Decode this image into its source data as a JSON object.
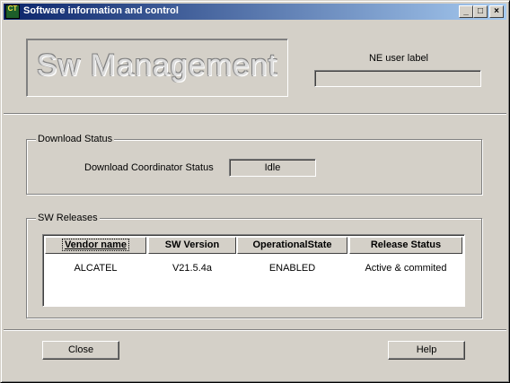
{
  "window": {
    "title": "Software information and control",
    "app_icon_text": "CT",
    "minimize_glyph": "_",
    "maximize_glyph": "□",
    "close_glyph": "×"
  },
  "header": {
    "logo_text": "Sw Management",
    "ne_user_label": "NE user label",
    "ne_user_value": ""
  },
  "download": {
    "group_title": "Download Status",
    "coordinator_label": "Download Coordinator Status",
    "coordinator_value": "Idle"
  },
  "releases": {
    "group_title": "SW Releases",
    "columns": [
      "Vendor name",
      "SW Version",
      "OperationalState",
      "Release Status"
    ],
    "rows": [
      [
        "ALCATEL",
        "V21.5.4a",
        "ENABLED",
        "Active & commited"
      ]
    ]
  },
  "footer": {
    "close_label": "Close",
    "help_label": "Help"
  }
}
